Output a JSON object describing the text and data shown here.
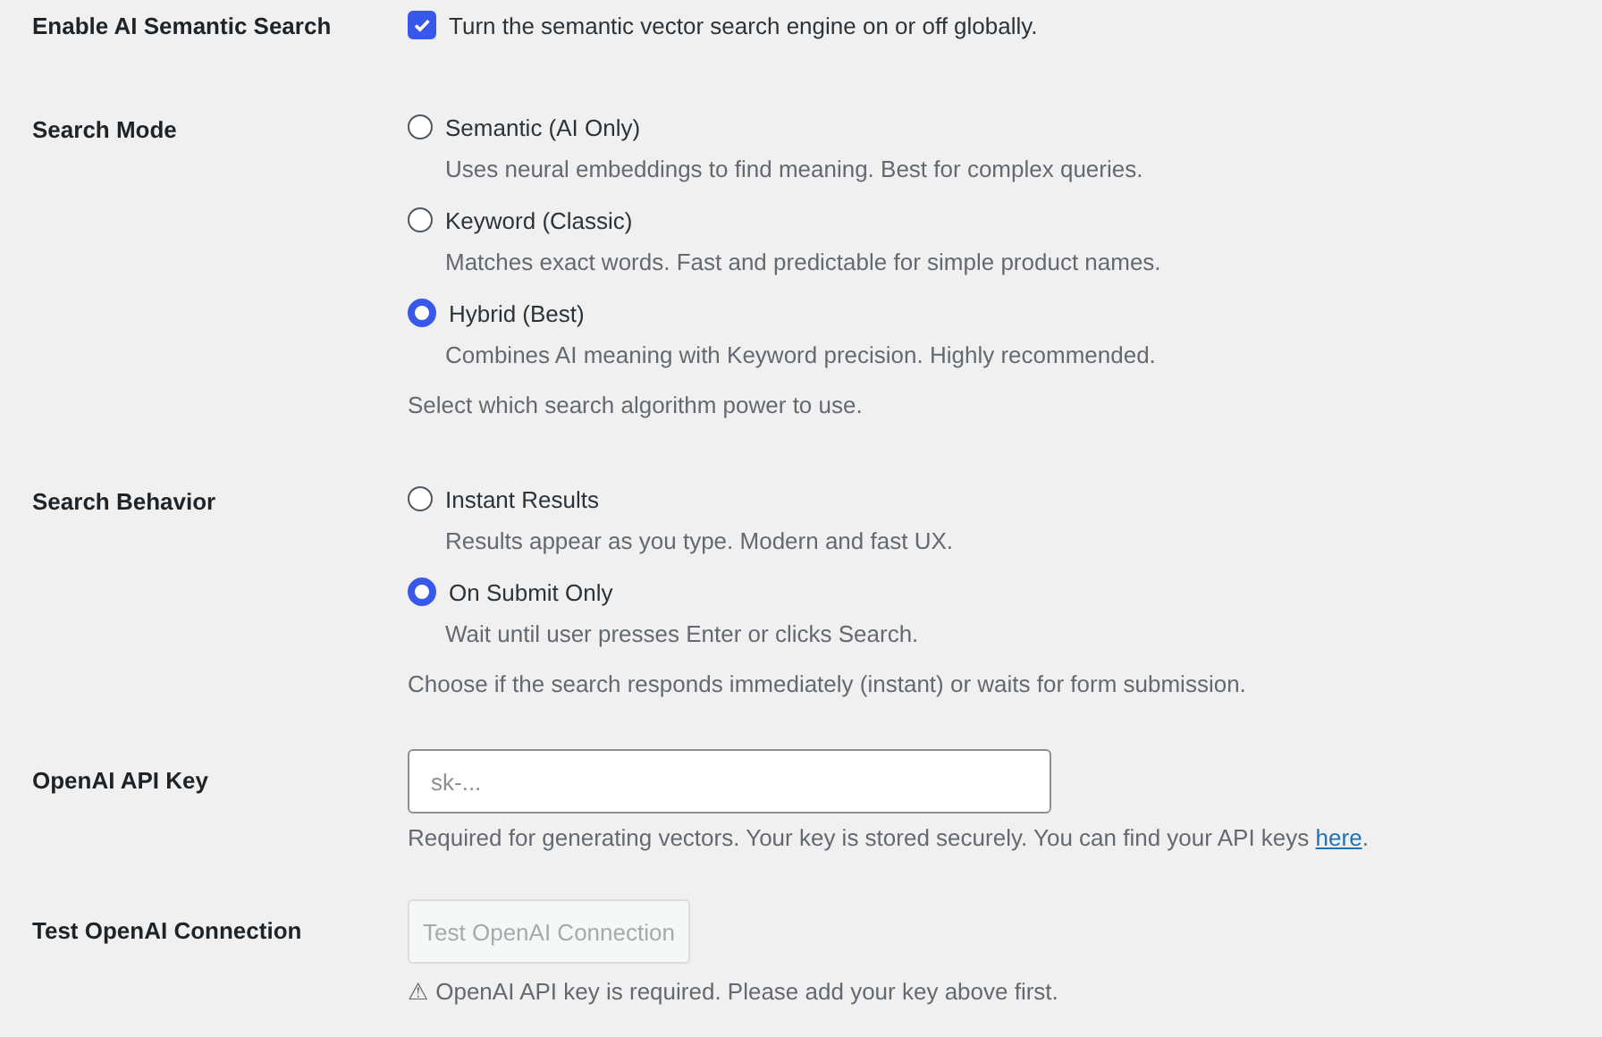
{
  "settings": [
    {
      "kind": "checkbox",
      "label": "Enable AI Semantic Search",
      "checked": true,
      "text": "Turn the semantic vector search engine on or off globally."
    },
    {
      "kind": "radio",
      "label": "Search Mode",
      "options": [
        {
          "label": "Semantic (AI Only)",
          "description": "Uses neural embeddings to find meaning. Best for complex queries.",
          "selected": false
        },
        {
          "label": "Keyword (Classic)",
          "description": "Matches exact words. Fast and predictable for simple product names.",
          "selected": false
        },
        {
          "label": "Hybrid (Best)",
          "description": "Combines AI meaning with Keyword precision. Highly recommended.",
          "selected": true
        }
      ],
      "help": "Select which search algorithm power to use."
    },
    {
      "kind": "radio",
      "label": "Search Behavior",
      "options": [
        {
          "label": "Instant Results",
          "description": "Results appear as you type. Modern and fast UX.",
          "selected": false
        },
        {
          "label": "On Submit Only",
          "description": "Wait until user presses Enter or clicks Search.",
          "selected": true
        }
      ],
      "help": "Choose if the search responds immediately (instant) or waits for form submission."
    },
    {
      "kind": "text",
      "label": "OpenAI API Key",
      "placeholder": "sk-...",
      "help": "Required for generating vectors. Your key is stored securely. You can find your API keys",
      "link": "here",
      "help_end": "."
    },
    {
      "kind": "button",
      "label": "Test OpenAI Connection",
      "button": "Test OpenAI Connection",
      "disabled": true,
      "help": "⚠ OpenAI API key is required. Please add your key above first."
    }
  ]
}
